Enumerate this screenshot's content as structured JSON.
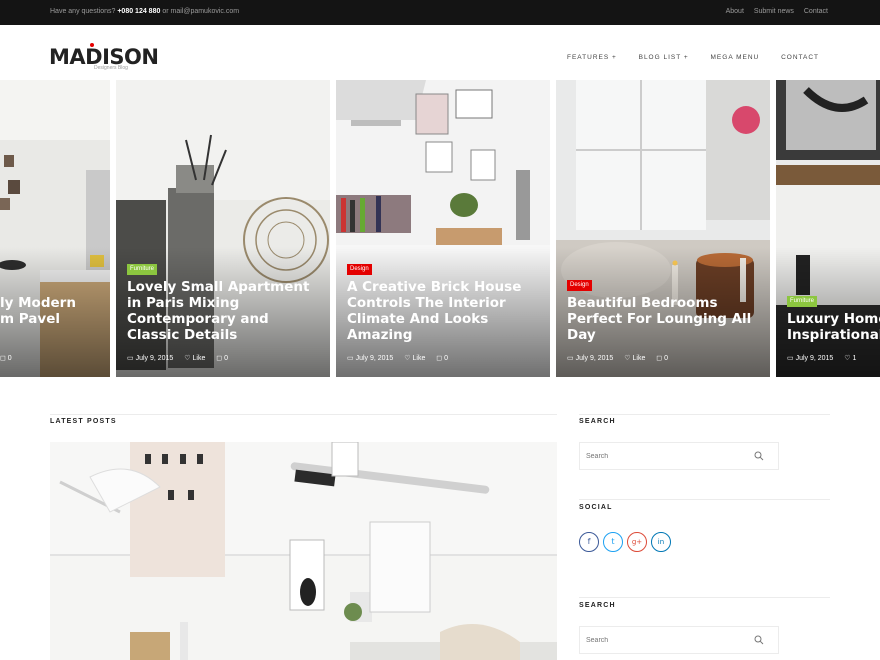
{
  "topbar": {
    "question": "Have any questions?",
    "phone": "+080 124 880",
    "email_prefix": "or",
    "email": "mail@pamukovic.com",
    "links": [
      "About",
      "Submit news",
      "Contact"
    ]
  },
  "header": {
    "logo": "MADISON",
    "tagline": "Designers Blog",
    "nav": [
      "FEATURES +",
      "BLOG LIST +",
      "MEGA MENU",
      "CONTACT"
    ]
  },
  "slider": [
    {
      "badge": "",
      "title": "...ly Modern\n...m Pavel",
      "date": "",
      "like": "",
      "comments": "0"
    },
    {
      "badge": "Furniture",
      "title": "Lovely Small Apartment in Paris Mixing Contemporary and Classic Details",
      "date": "July 9, 2015",
      "like": "Like",
      "comments": "0"
    },
    {
      "badge": "Design",
      "title": "A Creative Brick House Controls The Interior Climate And Looks Amazing",
      "date": "July 9, 2015",
      "like": "Like",
      "comments": "0"
    },
    {
      "badge": "Design",
      "title": "Beautiful Bedrooms Perfect For Lounging All Day",
      "date": "July 9, 2015",
      "like": "Like",
      "comments": "0"
    },
    {
      "badge": "Furniture",
      "title": "Luxury Home Inspirational",
      "date": "July 9, 2015",
      "like": "1",
      "comments": ""
    }
  ],
  "main": {
    "latest_posts": "LATEST POSTS"
  },
  "sidebar": {
    "search_title": "SEARCH",
    "search_placeholder": "Search",
    "social_title": "SOCIAL",
    "social_icons": [
      "f",
      "t",
      "g+",
      "in"
    ],
    "search2_title": "SEARCH",
    "search2_placeholder": "Search"
  },
  "colors": {
    "accent_red": "#e40000",
    "accent_green": "#8cc63f",
    "topbar": "#141414"
  }
}
